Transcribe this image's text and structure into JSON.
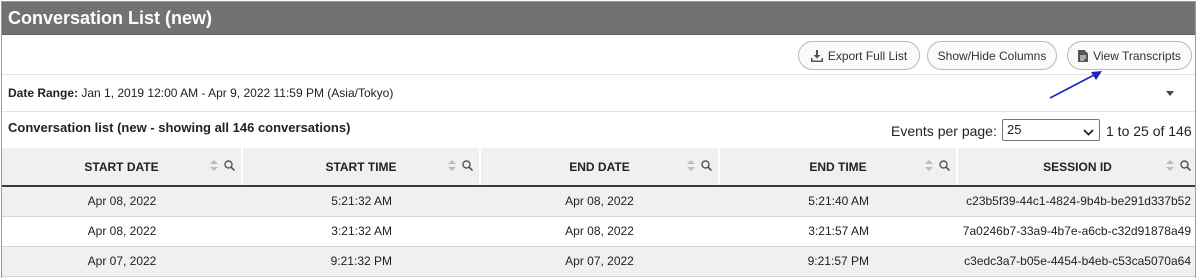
{
  "title": "Conversation List (new)",
  "toolbar": {
    "export_label": "Export Full List",
    "columns_label": "Show/Hide Columns",
    "transcripts_label": "View Transcripts",
    "export_icon": "download-icon",
    "transcripts_icon": "document-icon"
  },
  "date_range": {
    "label": "Date Range:",
    "value": "Jan 1, 2019 12:00 AM - Apr 9, 2022 11:59 PM (Asia/Tokyo)"
  },
  "list": {
    "title": "Conversation list (new - showing all 146 conversations)",
    "events_per_page_label": "Events per page:",
    "events_per_page_value": "25",
    "range_text": "1 to 25 of 146"
  },
  "table": {
    "headers": [
      "START DATE",
      "START TIME",
      "END DATE",
      "END TIME",
      "SESSION ID"
    ],
    "rows": [
      [
        "Apr 08, 2022",
        "5:21:32 AM",
        "Apr 08, 2022",
        "5:21:40 AM",
        "c23b5f39-44c1-4824-9b4b-be291d337b52"
      ],
      [
        "Apr 08, 2022",
        "3:21:32 AM",
        "Apr 08, 2022",
        "3:21:57 AM",
        "7a0246b7-33a9-4b7e-a6cb-c32d91878a49"
      ],
      [
        "Apr 07, 2022",
        "9:21:32 PM",
        "Apr 07, 2022",
        "9:21:57 PM",
        "c3edc3a7-b05e-4454-b4eb-c53ca5070a64"
      ]
    ]
  },
  "colors": {
    "title_bar": "#727272",
    "annotation_arrow": "#1a22c8"
  }
}
